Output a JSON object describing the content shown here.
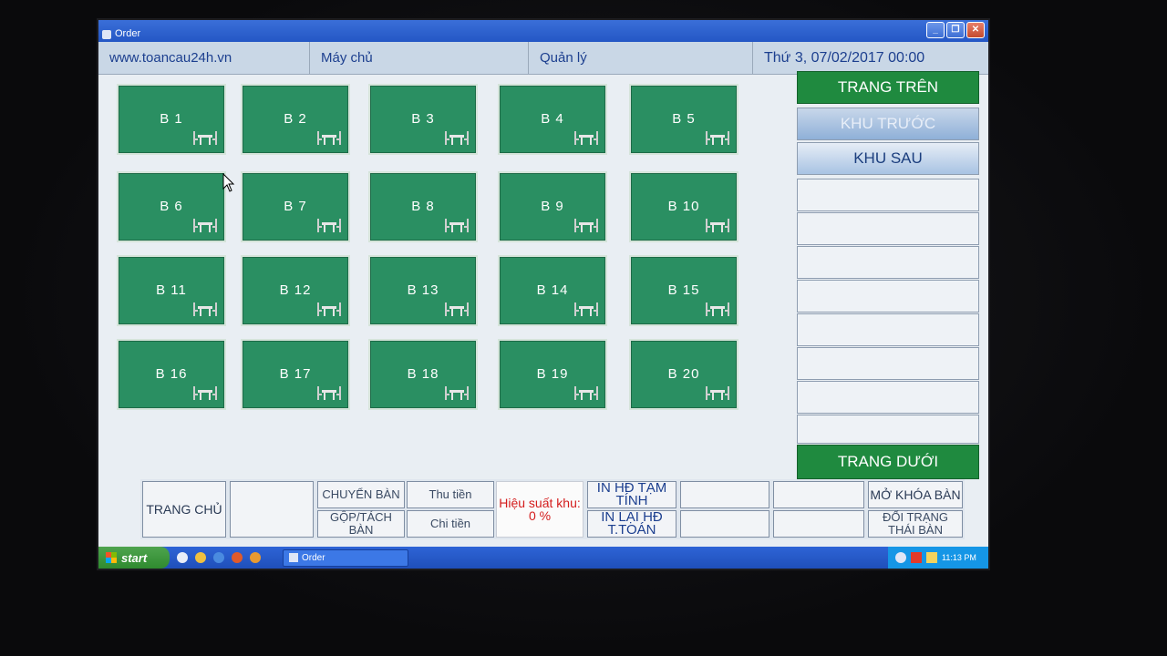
{
  "window": {
    "title": "Order"
  },
  "infobar": {
    "website": "www.toancau24h.vn",
    "server": "Máy chủ",
    "manager": "Quản lý",
    "datetime": "Thứ 3, 07/02/2017  00:00"
  },
  "tables": [
    {
      "label": "B 1"
    },
    {
      "label": "B 2"
    },
    {
      "label": "B 3"
    },
    {
      "label": "B 4"
    },
    {
      "label": "B 5"
    },
    {
      "label": "B 6"
    },
    {
      "label": "B 7"
    },
    {
      "label": "B 8"
    },
    {
      "label": "B 9"
    },
    {
      "label": "B 10"
    },
    {
      "label": "B 11"
    },
    {
      "label": "B 12"
    },
    {
      "label": "B 13"
    },
    {
      "label": "B 14"
    },
    {
      "label": "B 15"
    },
    {
      "label": "B 16"
    },
    {
      "label": "B 17"
    },
    {
      "label": "B 18"
    },
    {
      "label": "B 19"
    },
    {
      "label": "B 20"
    }
  ],
  "table_icon": "table-chairs-icon",
  "side": {
    "page_up": "TRANG TRÊN",
    "area_front": "KHU TRƯỚC",
    "area_back": "KHU SAU",
    "page_down": "TRANG DƯỚI"
  },
  "bottom": {
    "home": "TRANG CHỦ",
    "transfer": "CHUYỂN BÀN",
    "merge_split": "GỘP/TÁCH BÀN",
    "collect": "Thu tiền",
    "spend": "Chi tiền",
    "efficiency": "Hiệu suất khu: 0 %",
    "print_temp": "IN HĐ TẠM TÍNH",
    "reprint": "IN LẠI HĐ T.TOÁN",
    "unlock_table": "MỞ KHÓA BÀN",
    "change_status": "ĐỔI TRẠNG THÁI BÀN"
  },
  "taskbar": {
    "start": "start",
    "task_order": "Order",
    "clock": "11:13 PM"
  },
  "colors": {
    "table_green": "#2a8f62",
    "nav_green": "#1f8a3f",
    "titlebar_blue": "#2457c5",
    "accent_text": "#1c3f8f",
    "alert_red": "#d41c1c"
  }
}
